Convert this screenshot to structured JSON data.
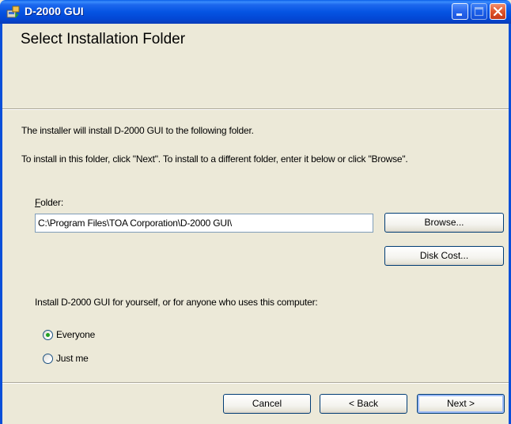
{
  "window": {
    "title": "D-2000 GUI"
  },
  "header": {
    "title": "Select Installation Folder"
  },
  "body": {
    "intro_line": "The installer will install D-2000 GUI to the following folder.",
    "instructions_line": "To install in this folder, click \"Next\". To install to a different folder, enter it below or click \"Browse\".",
    "folder_label_accel": "F",
    "folder_label_rest": "older:",
    "folder_value": "C:\\Program Files\\TOA Corporation\\D-2000 GUI\\",
    "browse_label": "Browse...",
    "disk_cost_label": "Disk Cost...",
    "install_for_prompt": "Install D-2000 GUI for yourself, or for anyone who uses this computer:",
    "radio_options": [
      {
        "label": "Everyone",
        "selected": true
      },
      {
        "label": "Just me",
        "selected": false
      }
    ]
  },
  "footer": {
    "cancel_label": "Cancel",
    "back_label": "< Back",
    "next_label": "Next >"
  },
  "colors": {
    "titlebar": "#0554e3",
    "dialog_bg": "#ece9d8",
    "radio_dot": "#21a121"
  }
}
